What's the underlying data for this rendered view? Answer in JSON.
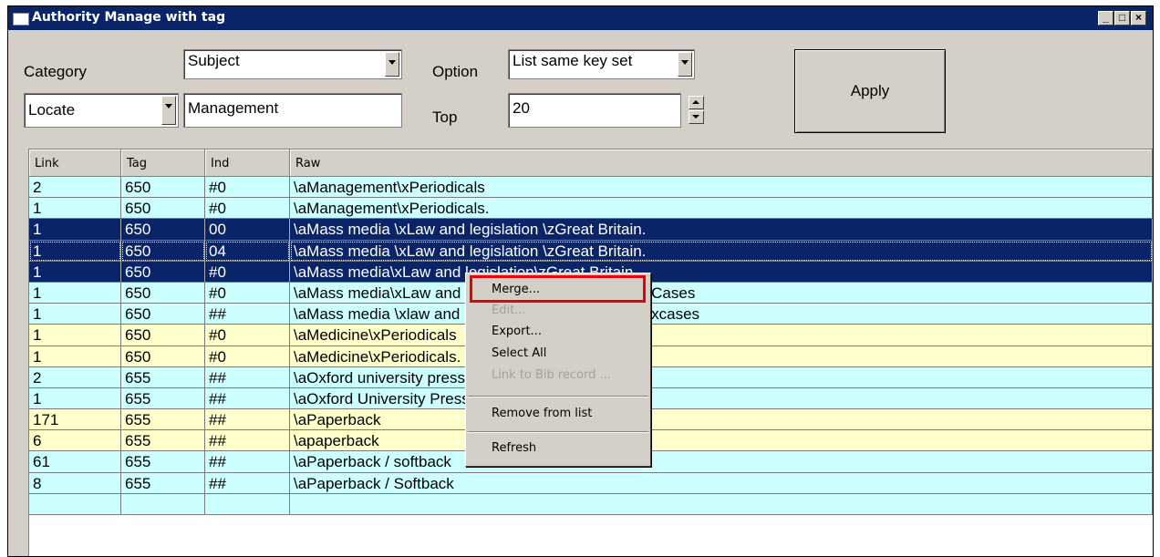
{
  "window": {
    "title": "Authority Manage with tag",
    "title_buttons": [
      "_",
      "□",
      "×"
    ]
  },
  "controls": {
    "category_label": "Category",
    "category_value": "Subject",
    "option_label": "Option",
    "option_value": "List same key set",
    "locate_value": "Locate",
    "search_value": "Management",
    "top_label": "Top",
    "top_value": "20",
    "apply_label": "Apply"
  },
  "grid": {
    "columns": [
      "Link",
      "Tag",
      "Ind",
      "Raw"
    ],
    "rows": [
      {
        "link": "2",
        "tag": "650",
        "ind": "#0",
        "raw": "\\aManagement\\xPeriodicals",
        "style": "cyan"
      },
      {
        "link": "1",
        "tag": "650",
        "ind": "#0",
        "raw": "\\aManagement\\xPeriodicals.",
        "style": "cyan"
      },
      {
        "link": "1",
        "tag": "650",
        "ind": "00",
        "raw": "\\aMass media \\xLaw and legislation \\zGreat Britain.",
        "style": "sel"
      },
      {
        "link": "1",
        "tag": "650",
        "ind": "04",
        "raw": "\\aMass media \\xLaw and legislation \\zGreat Britain.",
        "style": "sel focus"
      },
      {
        "link": "1",
        "tag": "650",
        "ind": "#0",
        "raw": "\\aMass media\\xLaw and legislation\\zGreat Britain",
        "style": "sel"
      },
      {
        "link": "1",
        "tag": "650",
        "ind": "#0",
        "raw": "\\aMass media\\xLaw and legislation\\zUnited States\\vCases",
        "style": "cyan"
      },
      {
        "link": "1",
        "tag": "650",
        "ind": "##",
        "raw": "\\aMass media \\xlaw and legislation \\zUnited States \\xcases",
        "style": "cyan"
      },
      {
        "link": "1",
        "tag": "650",
        "ind": "#0",
        "raw": "\\aMedicine\\xPeriodicals",
        "style": "yellow"
      },
      {
        "link": "1",
        "tag": "650",
        "ind": "#0",
        "raw": "\\aMedicine\\xPeriodicals.",
        "style": "yellow"
      },
      {
        "link": "2",
        "tag": "655",
        "ind": "##",
        "raw": "\\aOxford university press",
        "style": "cyan"
      },
      {
        "link": "1",
        "tag": "655",
        "ind": "##",
        "raw": "\\aOxford University Press",
        "style": "cyan"
      },
      {
        "link": "171",
        "tag": "655",
        "ind": "##",
        "raw": "\\aPaperback",
        "style": "yellow"
      },
      {
        "link": "6",
        "tag": "655",
        "ind": "##",
        "raw": "\\apaperback",
        "style": "yellow"
      },
      {
        "link": "61",
        "tag": "655",
        "ind": "##",
        "raw": "\\aPaperback / softback",
        "style": "cyan"
      },
      {
        "link": "8",
        "tag": "655",
        "ind": "##",
        "raw": "\\aPaperback / Softback",
        "style": "cyan"
      },
      {
        "link": "",
        "tag": "",
        "ind": "",
        "raw": "",
        "style": "cyan"
      }
    ]
  },
  "context_menu": {
    "items": [
      {
        "label": "Merge...",
        "enabled": true
      },
      {
        "label": "Edit...",
        "enabled": false
      },
      {
        "label": "Export...",
        "enabled": true
      },
      {
        "label": "Select All",
        "enabled": true
      },
      {
        "label": "Link to Bib record ...",
        "enabled": false
      },
      {
        "label": "Remove from list",
        "enabled": true
      },
      {
        "label": "Refresh",
        "enabled": true
      }
    ]
  },
  "colors": {
    "titlebar": "#0a246a",
    "row_cyan": "#ccffff",
    "row_yellow": "#ffffcc",
    "selection": "#0a246a",
    "highlight_box": "#e8000b"
  }
}
